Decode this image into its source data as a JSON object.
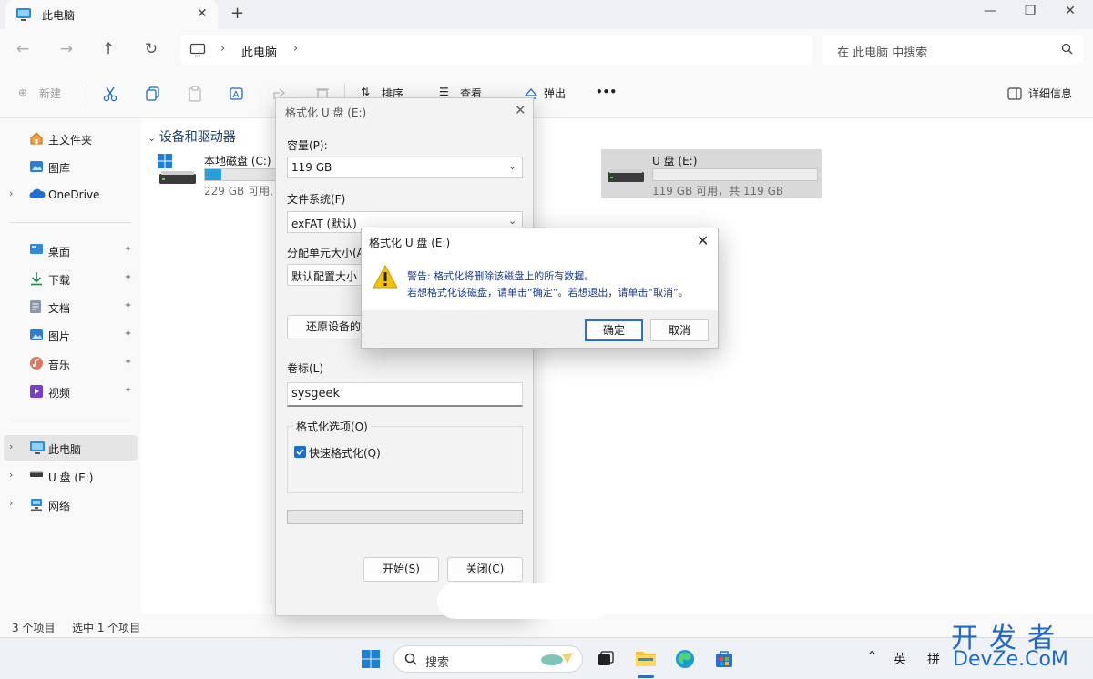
{
  "window": {
    "tab_title": "此电脑",
    "new_tab": "+",
    "minimize": "—",
    "maximize": "❐",
    "close": "✕"
  },
  "address": {
    "crumb": "此电脑",
    "separator": "›",
    "search_placeholder": "在 此电脑 中搜索"
  },
  "toolbar": {
    "new_label": "新建",
    "sort_label": "排序",
    "view_label": "查看",
    "eject_label": "弹出",
    "more_label": "•••",
    "details_label": "详细信息"
  },
  "sidebar": {
    "quick": [
      {
        "label": "主文件夹",
        "icon": "home-icon"
      },
      {
        "label": "图库",
        "icon": "gallery-icon"
      },
      {
        "label": "OneDrive",
        "icon": "cloud-icon"
      }
    ],
    "pinned": [
      {
        "label": "桌面",
        "icon": "desktop-icon"
      },
      {
        "label": "下载",
        "icon": "download-icon"
      },
      {
        "label": "文档",
        "icon": "document-icon"
      },
      {
        "label": "图片",
        "icon": "pictures-icon"
      },
      {
        "label": "音乐",
        "icon": "music-icon"
      },
      {
        "label": "视频",
        "icon": "video-icon"
      }
    ],
    "devices": [
      {
        "label": "此电脑",
        "icon": "computer-icon"
      },
      {
        "label": "U 盘 (E:)",
        "icon": "usb-drive-icon"
      },
      {
        "label": "网络",
        "icon": "network-icon"
      }
    ],
    "pin_glyph": "📌"
  },
  "main": {
    "group_header": "设备和驱动器",
    "drives": [
      {
        "name": "本地磁盘 (C:)",
        "space": "229 GB 可用,",
        "used_fraction": 0.1
      },
      {
        "name": "U 盘 (E:)",
        "space": "119 GB 可用，共 119 GB",
        "used_fraction": 0.0
      }
    ]
  },
  "status": {
    "count": "3 个项目",
    "selected": "选中 1 个项目"
  },
  "format_dialog": {
    "title": "格式化 U 盘 (E:)",
    "capacity_label": "容量(P):",
    "capacity_value": "119 GB",
    "fs_label": "文件系统(F)",
    "fs_value": "exFAT (默认)",
    "alloc_label": "分配单元大小(A",
    "alloc_value": "默认配置大小",
    "restore_label": "还原设备的默",
    "volume_label": "卷标(L)",
    "volume_value": "sysgeek",
    "options_label": "格式化选项(O)",
    "quick_format_label": "快速格式化(Q)",
    "quick_format_checked": true,
    "start_label": "开始(S)",
    "close_label": "关闭(C)"
  },
  "warning_dialog": {
    "title": "格式化 U 盘 (E:)",
    "line1": "警告: 格式化将删除该磁盘上的所有数据。",
    "line2": "若想格式化该磁盘，请单击“确定”。若想退出，请单击“取消”。",
    "ok_label": "确定",
    "cancel_label": "取消"
  },
  "taskbar": {
    "search_label": "搜索",
    "ime_lang": "英",
    "ime_mode": "拼",
    "tray_chevron": "^"
  },
  "watermark": {
    "line1": "开发者",
    "line2": "DevZe.CoM"
  },
  "colors": {
    "accent": "#26a0da",
    "selection": "#e5e5e5",
    "warning": "#f4c20d",
    "dialog_default_button": "#2f6fcf"
  }
}
